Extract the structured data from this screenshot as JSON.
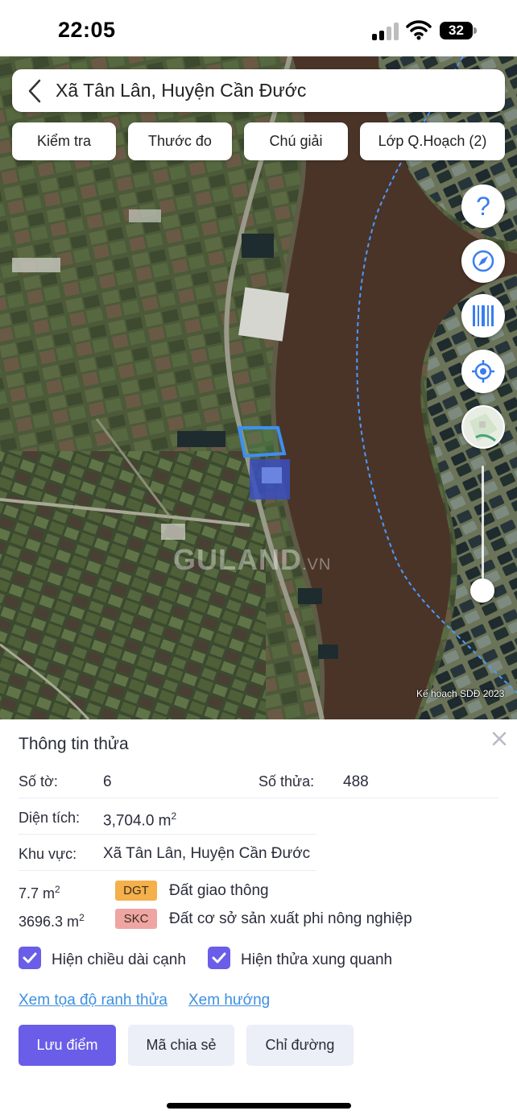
{
  "status_bar": {
    "time": "22:05",
    "battery": "32"
  },
  "search": {
    "title": "Xã Tân Lân, Huyện Cần Đước"
  },
  "toolbar": [
    {
      "label": "Kiểm tra"
    },
    {
      "label": "Thước đo"
    },
    {
      "label": "Chú giải"
    },
    {
      "label": "Lớp Q.Hoạch (2)"
    }
  ],
  "map_controls": {
    "icons": [
      "help-icon",
      "compass-icon",
      "barcode-icon",
      "locate-icon",
      "map-layer-icon"
    ],
    "help_glyph": "?"
  },
  "map": {
    "watermark_main": "GULAND",
    "watermark_suffix": ".VN",
    "credit": "Kế hoạch SDĐ 2023",
    "parcel_outline_color": "#3d8ff2",
    "river_color": "#4a3428"
  },
  "parcel_info": {
    "title": "Thông tin thửa",
    "so_to_label": "Số tờ:",
    "so_to_value": "6",
    "so_thua_label": "Số thửa:",
    "so_thua_value": "488",
    "dien_tich_label": "Diện tích:",
    "dien_tich_value": "3,704.0 m",
    "area_unit_exp": "2",
    "khu_vuc_label": "Khu vực:",
    "khu_vuc_value": "Xã Tân Lân, Huyện Cần Đước",
    "land_uses": [
      {
        "area": "7.7 m",
        "exp": "2",
        "code": "DGT",
        "name": "Đất giao thông",
        "color": "#f3b04b"
      },
      {
        "area": "3696.3 m",
        "exp": "2",
        "code": "SKC",
        "name": "Đất cơ sở sản xuất phi nông nghiệp",
        "color": "#efa5a2"
      }
    ]
  },
  "options": {
    "show_edge_length": "Hiện chiều dài cạnh",
    "show_edge_length_checked": true,
    "show_neighbors": "Hiện thửa xung quanh",
    "show_neighbors_checked": true
  },
  "links": {
    "coords": "Xem tọa độ ranh thửa",
    "direction": "Xem hướng"
  },
  "actions": {
    "save": "Lưu điểm",
    "share": "Mã chia sẻ",
    "directions": "Chỉ đường"
  },
  "colors": {
    "accent": "#6a5de8",
    "link": "#3d8fe0"
  }
}
